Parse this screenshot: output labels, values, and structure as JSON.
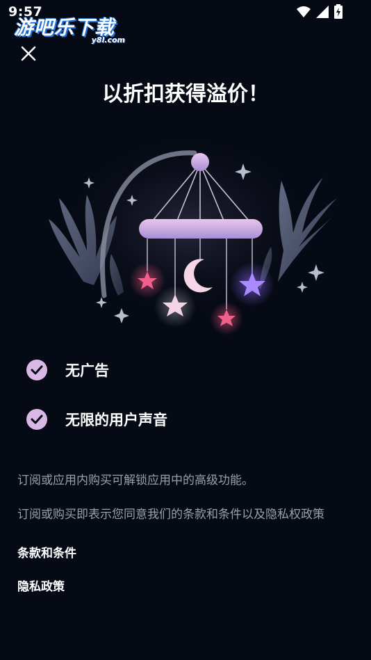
{
  "status_bar": {
    "time": "9:57",
    "icons": [
      "wifi-icon",
      "signal-icon",
      "battery-charging-icon"
    ]
  },
  "watermark": {
    "main": "游吧乐下载",
    "sub": "y8l.com"
  },
  "header": {
    "close_icon": "close-icon",
    "title": "以折扣获得溢价！"
  },
  "features": [
    {
      "icon": "check-circle-icon",
      "label": "无广告"
    },
    {
      "icon": "check-circle-icon",
      "label": "无限的用户声音"
    }
  ],
  "descriptions": {
    "unlock": "订阅或应用内购买可解锁应用中的高级功能。",
    "agreement": "订阅或购买即表示您同意我们的条款和条件以及隐私权政策"
  },
  "links": {
    "terms": "条款和条件",
    "privacy": "隐私政策"
  },
  "colors": {
    "background": "#060A14",
    "check_fill": "#D9B8E8",
    "text_secondary": "#9AA0AD",
    "star_pink": "#F0608A",
    "star_purple": "#A98BFF",
    "moon": "#F6D6E4"
  }
}
